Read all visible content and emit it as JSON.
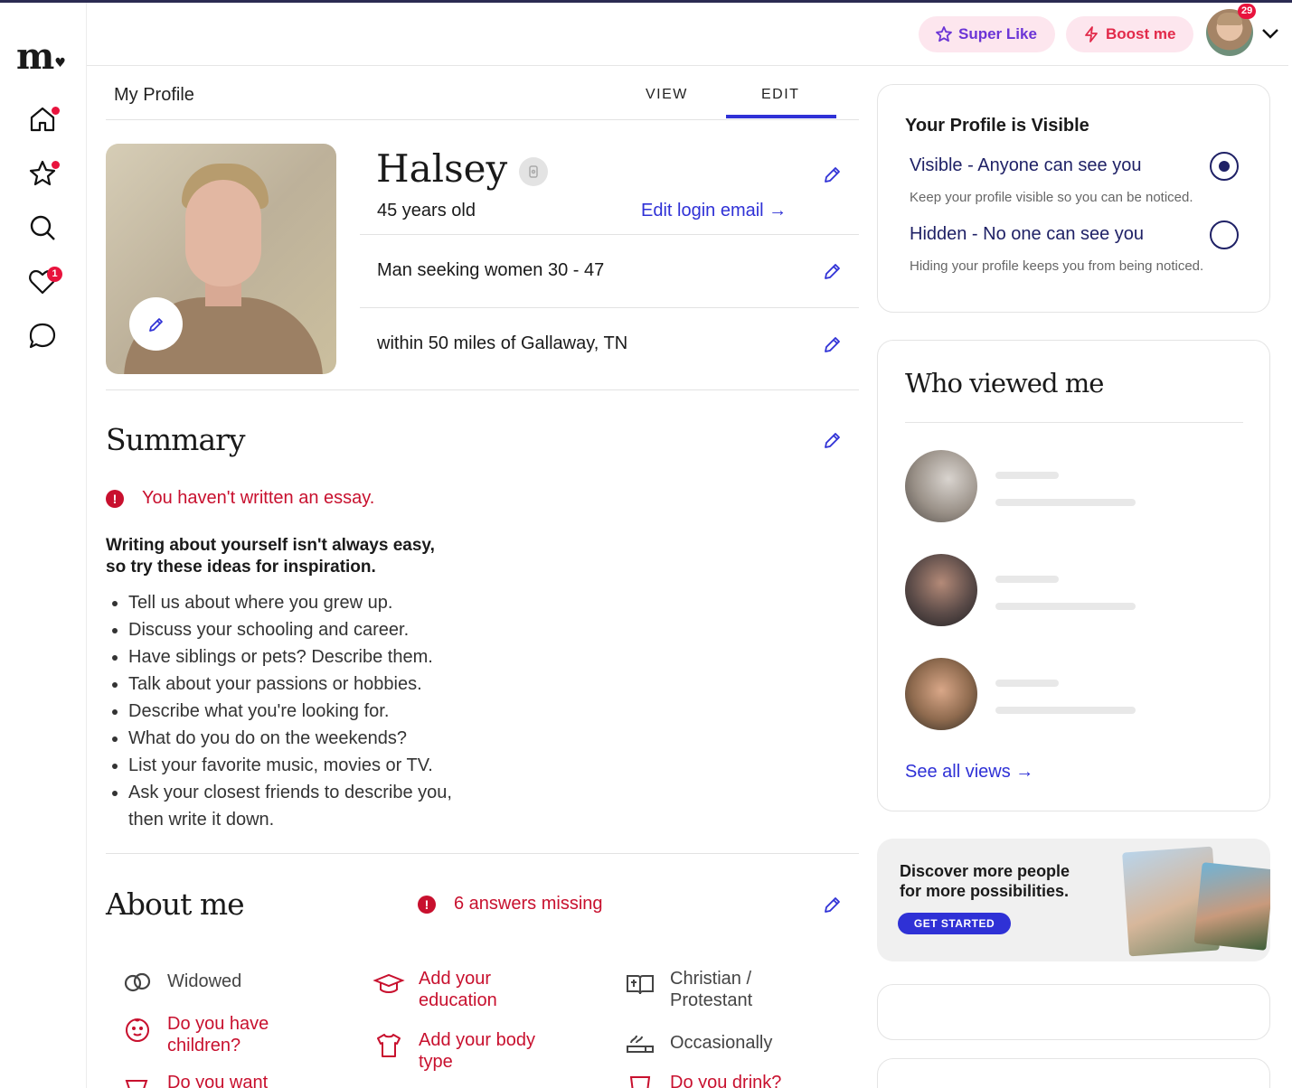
{
  "brand": {
    "logo_text": "m",
    "logo_heart": "♥"
  },
  "nav": {
    "icons": [
      "home-icon",
      "star-icon",
      "search-icon",
      "heart-icon",
      "chat-icon"
    ],
    "likes_badge": "1"
  },
  "header": {
    "super_like_label": "Super Like",
    "boost_label": "Boost me",
    "notifications_count": "29"
  },
  "tabs": {
    "title": "My Profile",
    "view_label": "VIEW",
    "edit_label": "EDIT",
    "active": "EDIT"
  },
  "profile": {
    "name": "Halsey",
    "age": "45 years old",
    "edit_login_email": "Edit login email →",
    "seeking": "Man seeking women 30 - 47",
    "location": "within 50 miles of Gallaway, TN"
  },
  "summary": {
    "title": "Summary",
    "warning": "You haven't written an essay.",
    "inspiration_line1": "Writing about yourself isn't always easy,",
    "inspiration_line2": "so try these ideas for inspiration.",
    "ideas": [
      "Tell us about where you grew up.",
      "Discuss your schooling and career.",
      "Have siblings or pets? Describe them.",
      "Talk about your passions or hobbies.",
      "Describe what you're looking for.",
      "What do you do on the weekends?",
      "List your favorite music, movies or TV.",
      "Ask your closest friends to describe you, then write it down."
    ]
  },
  "about": {
    "title": "About me",
    "missing": "6 answers missing",
    "items": [
      {
        "icon": "rings-icon",
        "text": "Widowed",
        "state": "answered"
      },
      {
        "icon": "graduation-cap-icon",
        "text": "Add your education",
        "state": "missing"
      },
      {
        "icon": "book-cross-icon",
        "text": "Christian / Protestant",
        "state": "answered"
      },
      {
        "icon": "baby-face-icon",
        "text": "Do you have children?",
        "state": "missing"
      },
      {
        "icon": "shirt-icon",
        "text": "Add your body type",
        "state": "missing"
      },
      {
        "icon": "smoking-icon",
        "text": "Occasionally",
        "state": "answered"
      },
      {
        "icon": "stroller-icon",
        "text": "Do you want",
        "state": "missing"
      },
      {
        "icon": "glass-icon",
        "text": "Do you drink?",
        "state": "missing"
      }
    ]
  },
  "visibility": {
    "title": "Your Profile is Visible",
    "visible_label": "Visible - Anyone can see you",
    "visible_sub": "Keep your profile visible so you can be noticed.",
    "hidden_label": "Hidden - No one can see you",
    "hidden_sub": "Hiding your profile keeps you from being noticed.",
    "selected": "visible"
  },
  "who_viewed": {
    "title": "Who viewed me",
    "see_all": "See all views →"
  },
  "promo": {
    "line1": "Discover more people",
    "line2": "for more possibilities.",
    "button": "GET STARTED"
  },
  "colors": {
    "accent": "#2f31d6",
    "alert": "#c8102e",
    "badge": "#e8133d",
    "navy": "#1f2166"
  }
}
